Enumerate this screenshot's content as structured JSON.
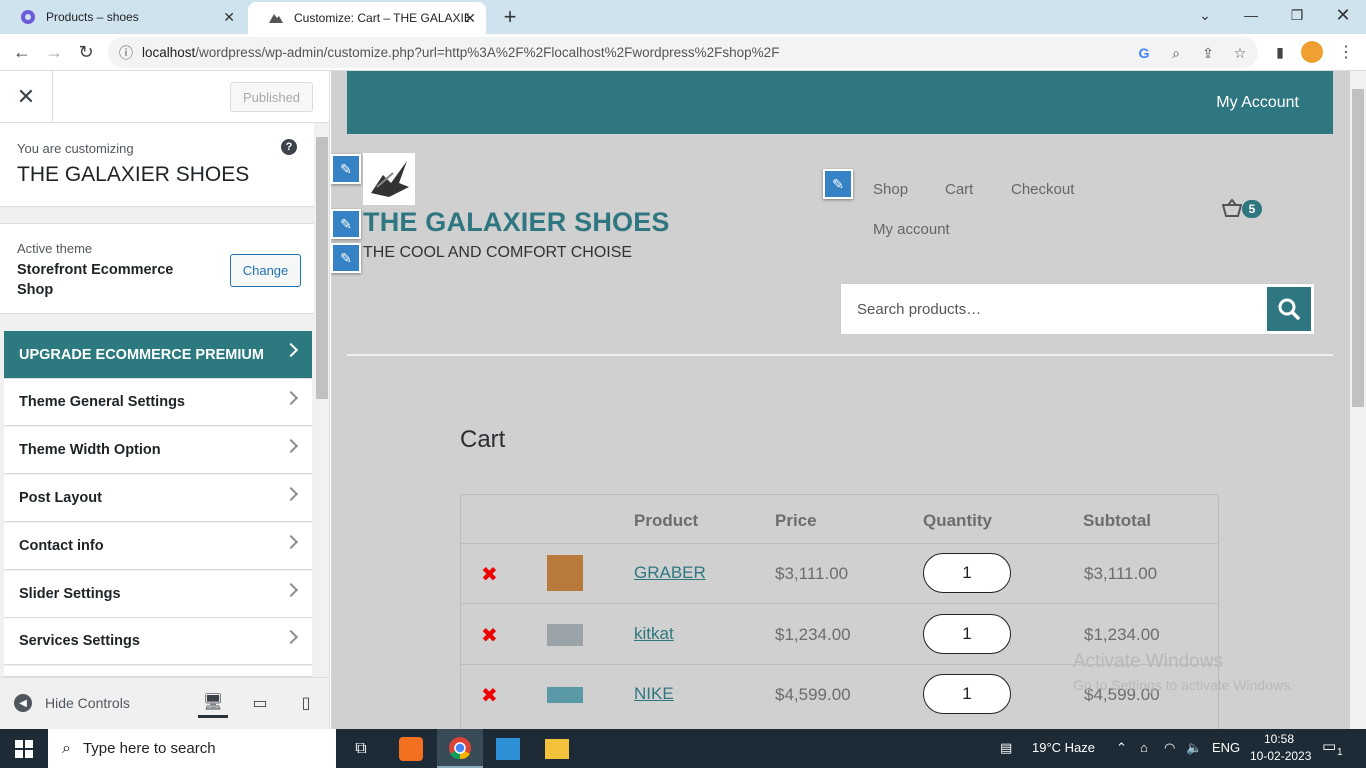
{
  "browser": {
    "tabs": [
      {
        "title": "Products – shoes"
      },
      {
        "title": "Customize: Cart – THE GALAXIER"
      }
    ],
    "url_host": "localhost",
    "url_path": "/wordpress/wp-admin/customize.php?url=http%3A%2F%2Flocalhost%2Fwordpress%2Fshop%2F"
  },
  "customizer": {
    "published_label": "Published",
    "customizing_label": "You are customizing",
    "site_name": "THE GALAXIER SHOES",
    "active_theme_label": "Active theme",
    "theme_name": "Storefront Ecommerce Shop",
    "change_label": "Change",
    "sections": [
      {
        "label": "UPGRADE ECOMMERCE PREMIUM"
      },
      {
        "label": "Theme General Settings"
      },
      {
        "label": "Theme Width Option"
      },
      {
        "label": "Post Layout"
      },
      {
        "label": "Contact info"
      },
      {
        "label": "Slider Settings"
      },
      {
        "label": "Services Settings"
      }
    ],
    "hide_controls_label": "Hide Controls"
  },
  "preview": {
    "top_link": "My Account",
    "site_title": "THE GALAXIER SHOES",
    "tagline": "THE COOL AND COMFORT CHOISE",
    "nav": [
      "Shop",
      "Cart",
      "Checkout",
      "My account"
    ],
    "cart_count": "5",
    "search_placeholder": "Search products…",
    "page_title": "Cart",
    "table_headers": [
      "Product",
      "Price",
      "Quantity",
      "Subtotal"
    ],
    "cart_items": [
      {
        "name": "GRABER",
        "price": "$3,111.00",
        "qty": "1",
        "subtotal": "$3,111.00"
      },
      {
        "name": "kitkat",
        "price": "$1,234.00",
        "qty": "1",
        "subtotal": "$1,234.00"
      },
      {
        "name": "NIKE",
        "price": "$4,599.00",
        "qty": "1",
        "subtotal": "$4,599.00"
      }
    ],
    "watermark_line1": "Activate Windows",
    "watermark_line2": "Go to Settings to activate Windows."
  },
  "taskbar": {
    "search_placeholder": "Type here to search",
    "weather": "19°C  Haze",
    "language": "ENG",
    "time": "10:58",
    "date": "10-02-2023",
    "notifications": "1"
  },
  "colors": {
    "accent": "#2f7780",
    "wp_blue": "#2271b1",
    "remove_red": "#e00000"
  }
}
